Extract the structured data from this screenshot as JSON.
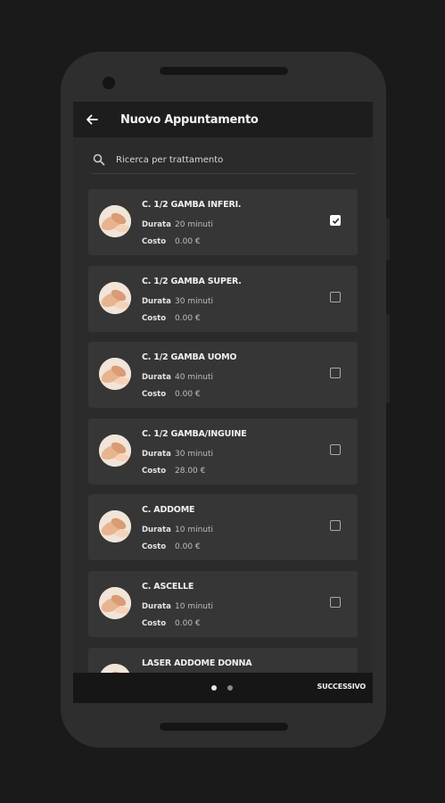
{
  "appbar": {
    "title": "Nuovo Appuntamento",
    "back_icon": "arrow-left-icon"
  },
  "search": {
    "placeholder": "Ricerca per trattamento",
    "icon": "search-icon"
  },
  "labels": {
    "duration": "Durata",
    "cost": "Costo"
  },
  "treatments": [
    {
      "name": "C. 1/2 GAMBA INFERI.",
      "duration": "20 minuti",
      "cost": "0.00 €",
      "checked": true
    },
    {
      "name": "C. 1/2 GAMBA SUPER.",
      "duration": "30 minuti",
      "cost": "0.00 €",
      "checked": false
    },
    {
      "name": "C. 1/2 GAMBA UOMO",
      "duration": "40 minuti",
      "cost": "0.00 €",
      "checked": false
    },
    {
      "name": "C. 1/2 GAMBA/INGUINE",
      "duration": "30 minuti",
      "cost": "28.00 €",
      "checked": false
    },
    {
      "name": "C. ADDOME",
      "duration": "10 minuti",
      "cost": "0.00 €",
      "checked": false
    },
    {
      "name": "C. ASCELLE",
      "duration": "10 minuti",
      "cost": "0.00 €",
      "checked": false
    },
    {
      "name": "LASER ADDOME DONNA",
      "duration": "",
      "cost": "",
      "checked": false
    }
  ],
  "pager": {
    "page": 1,
    "pages": 2
  },
  "footer": {
    "next_label": "SUCCESSIVO"
  },
  "colors": {
    "background": "#1a1a1a",
    "device": "#2e2e2e",
    "screen": "#2b2b2b",
    "card": "#363636",
    "bar": "#161616"
  }
}
